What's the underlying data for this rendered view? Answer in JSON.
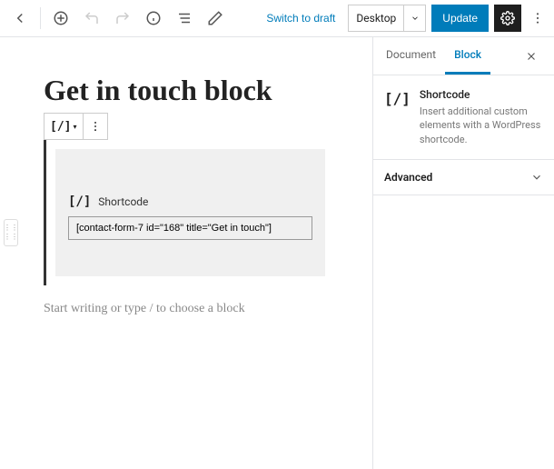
{
  "topbar": {
    "switch_draft": "Switch to draft",
    "device_label": "Desktop",
    "update_label": "Update"
  },
  "editor": {
    "page_title": "Get in touch block",
    "shortcode_block": {
      "icon_text": "[/]",
      "label": "Shortcode",
      "value": "[contact-form-7 id=\"168\" title=\"Get in touch\"]"
    },
    "placeholder": "Start writing or type / to choose a block",
    "toolbar_icon": "[/]"
  },
  "sidebar": {
    "tabs": {
      "document": "Document",
      "block": "Block"
    },
    "block_info": {
      "icon_text": "[/]",
      "name": "Shortcode",
      "description": "Insert additional custom elements with a WordPress shortcode."
    },
    "panels": {
      "advanced": "Advanced"
    }
  }
}
